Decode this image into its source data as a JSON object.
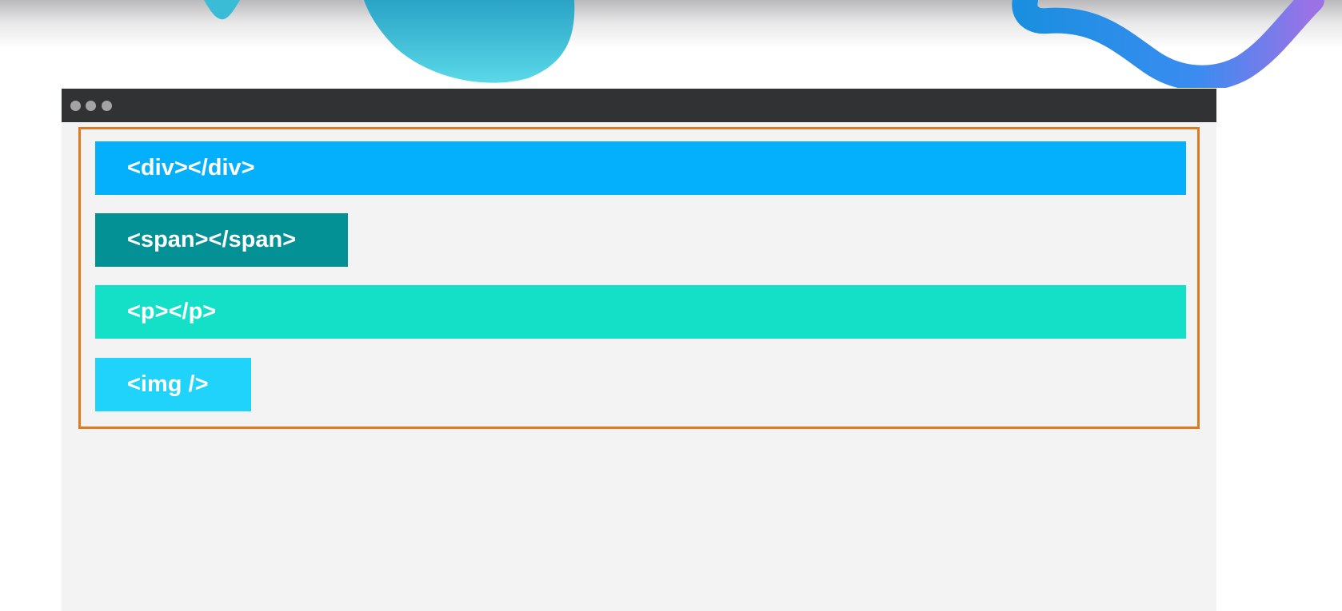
{
  "browser": {
    "window_controls": [
      "dot",
      "dot",
      "dot"
    ]
  },
  "elements": [
    {
      "label": "<div></div>",
      "color": "#04b0fc",
      "kind": "block"
    },
    {
      "label": "<span></span>",
      "color": "#039196",
      "kind": "inline"
    },
    {
      "label": "<p></p>",
      "color": "#14e0c7",
      "kind": "block"
    },
    {
      "label": "<img />",
      "color": "#20d3fb",
      "kind": "inline"
    }
  ],
  "colors": {
    "container_border": "#e07a1f",
    "titlebar": "#313234",
    "content_background": "#f3f3f3"
  }
}
